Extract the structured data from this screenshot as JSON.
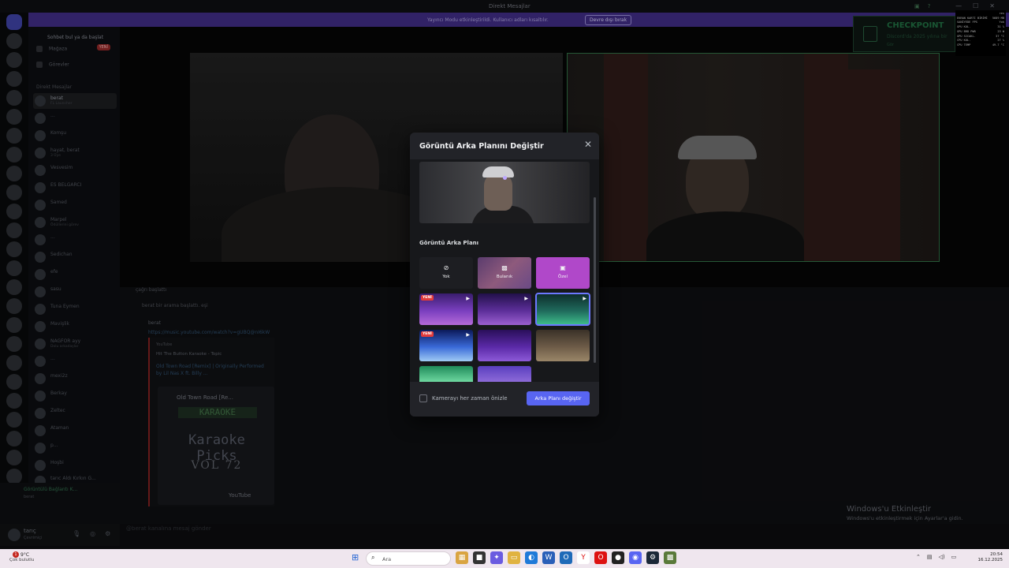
{
  "window": {
    "title": "Direkt Mesajlar"
  },
  "banner": {
    "text": "Yayıncı Modu etkinleştirildi. Kullanıcı adları kısaltılır.",
    "button": "Devre dışı bırak"
  },
  "dms": {
    "header": "Sohbet bul ya da başlat",
    "links": [
      {
        "label": "Mağaza",
        "icon": "shop-icon"
      },
      {
        "label": "Görevler",
        "icon": "quests-icon"
      }
    ],
    "new_badge": "YENİ",
    "section": "Direkt Mesajlar",
    "items": [
      {
        "name": "berat",
        "sub": "FL Launcher"
      },
      {
        "name": "...",
        "sub": ""
      },
      {
        "name": "Komşu",
        "sub": ""
      },
      {
        "name": "hayat, berat",
        "sub": "3 Üye"
      },
      {
        "name": "Vesvesim",
        "sub": ""
      },
      {
        "name": "ES BELGARCI",
        "sub": ""
      },
      {
        "name": "Samed",
        "sub": ""
      },
      {
        "name": "Marpel",
        "sub": "Ödüllerini görev"
      },
      {
        "name": "...",
        "sub": ""
      },
      {
        "name": "Sedichan",
        "sub": ""
      },
      {
        "name": "efe",
        "sub": ""
      },
      {
        "name": "sasu",
        "sub": ""
      },
      {
        "name": "Tuna Eymen",
        "sub": ""
      },
      {
        "name": "Mavişlik",
        "sub": ""
      },
      {
        "name": "NAGFOR ayy",
        "sub": "Dolu arkadaşlar"
      },
      {
        "name": "...",
        "sub": ""
      },
      {
        "name": "mexi2z",
        "sub": ""
      },
      {
        "name": "Berkay",
        "sub": ""
      },
      {
        "name": "Zeltec",
        "sub": ""
      },
      {
        "name": "Ataman",
        "sub": ""
      },
      {
        "name": "p...",
        "sub": ""
      },
      {
        "name": "Hoşbi",
        "sub": ""
      },
      {
        "name": "tarıc Aldı Kırkın G...",
        "sub": ""
      }
    ]
  },
  "voice": {
    "status": "Görüntülü Bağlantı K...",
    "channel": "berat"
  },
  "user": {
    "name": "tarıç",
    "status": "Çevrimiçi"
  },
  "chat": {
    "line1": "çağrı başlattı",
    "line2": "berat bir arama başlattı. eşi",
    "author": "berat",
    "link": "https://music.youtube.com/watch?v=gUBQ@nI6kW",
    "embed": {
      "provider": "YouTube",
      "channel": "Hit The Button Karaoke - Topic",
      "title": "Old Town Road [Remix] | Originally Performed by Lil Nas X ft. Billy ...",
      "video_title": "Old Town Road [Re...",
      "karaoke": "KARAOKE",
      "picks": "Karaoke Picks",
      "vol": "VOL 72",
      "youtube": "YouTube"
    },
    "input_placeholder": "@berat kanalına mesaj gönder"
  },
  "activation": {
    "title": "Windows'u Etkinleştir",
    "sub": "Windows'u etkinleştirmek için Ayarlar'a gidin."
  },
  "checkpoint": {
    "brand": "CHECKPOINT",
    "sub": "Discord'da 2025 yılına bir",
    "link": "Gör"
  },
  "osd": {
    "rows": [
      {
        "k": "",
        "v": "res"
      },
      {
        "k": "EKRAN KARTI BİRİMİ",
        "v": "5689 MB"
      },
      {
        "k": "SANİYEDE FPS",
        "v": "Yok"
      },
      {
        "k": "GPU KUL.",
        "v": "31 %"
      },
      {
        "k": "GPU BRD PWR",
        "v": "23 W"
      },
      {
        "k": "GPU SICAKL.",
        "v": "37 °C"
      },
      {
        "k": "CPU KUL.",
        "v": "27 %"
      },
      {
        "k": "CPU TEMP",
        "v": "49.7 °C"
      }
    ]
  },
  "modal": {
    "title": "Görüntü Arka Planını Değiştir",
    "section_label": "Görüntü Arka Planı",
    "options": [
      {
        "label": "Yok",
        "icon": "none-icon",
        "glyph": "⊘"
      },
      {
        "label": "Bulanık",
        "icon": "blur-icon",
        "glyph": "▩"
      },
      {
        "label": "Özel",
        "icon": "custom-image-icon",
        "glyph": "▣"
      }
    ],
    "new_tag": "YENİ",
    "checkbox_label": "Kamerayı her zaman önizle",
    "primary_button": "Arka Planı değiştir"
  },
  "taskbar": {
    "weather_temp": "9°C",
    "weather_text": "Çok bulutlu",
    "weather_badge": "1",
    "search_placeholder": "Ara",
    "time": "20:54",
    "date": "16.12.2025"
  },
  "colors": {
    "accent": "#5865f2",
    "custom_bg": "#b048c9",
    "new_tag": "#e23b3b",
    "banner": "#3c2a7d"
  }
}
